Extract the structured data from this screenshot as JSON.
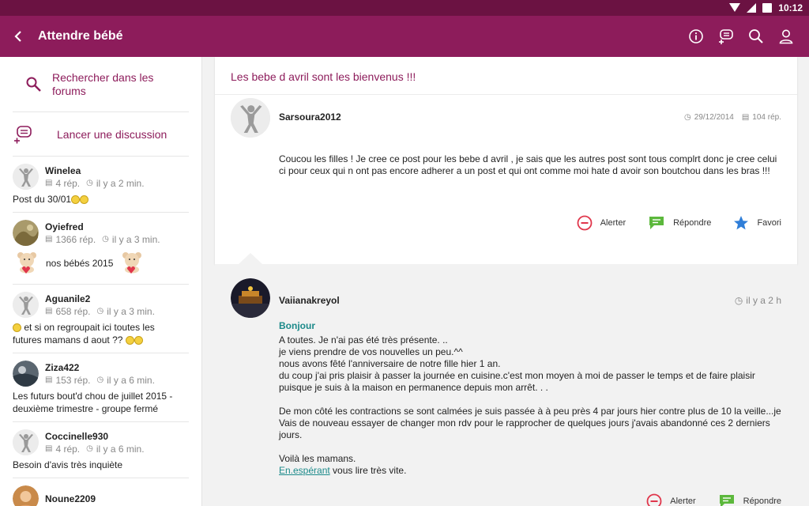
{
  "status": {
    "time": "10:12"
  },
  "app_bar": {
    "title": "Attendre bébé"
  },
  "sidebar": {
    "search_label": "Rechercher dans les forums",
    "new_discussion_label": "Lancer une discussion",
    "threads": [
      {
        "user": "Winelea",
        "replies": "4 rép.",
        "time": "il y a 2 min.",
        "title": "Post du 30/01"
      },
      {
        "user": "Oyiefred",
        "replies": "1366 rép.",
        "time": "il y a 3 min.",
        "title": "nos bébés 2015"
      },
      {
        "user": "Aguanile2",
        "replies": "658 rép.",
        "time": "il y a 3 min.",
        "title_a": "et si on regroupait ici toutes les",
        "title_b": "futures mamans d aout ??"
      },
      {
        "user": "Ziza422",
        "replies": "153 rép.",
        "time": "il y a 6 min.",
        "title_a": "Les futurs bout'd chou de juillet 2015 -",
        "title_b": "deuxième trimestre - groupe fermé"
      },
      {
        "user": "Coccinelle930",
        "replies": "4 rép.",
        "time": "il y a 6 min.",
        "title": "Besoin d'avis très inquiète"
      },
      {
        "user": "Noune2209"
      }
    ]
  },
  "post": {
    "title": "Les bebe d avril sont les bienvenus !!!",
    "author": "Sarsoura2012",
    "date": "29/12/2014",
    "replies": "104 rép.",
    "body": "Coucou les filles ! Je cree ce post pour les bebe d avril , je sais que les autres post sont tous complrt donc je cree celui ci pour ceux qui n ont pas encore adherer a un post et qui ont comme moi hate d avoir son boutchou dans les bras !!!",
    "actions": {
      "report": "Alerter",
      "reply": "Répondre",
      "fav": "Favori"
    }
  },
  "reply": {
    "author": "Vaiianakreyol",
    "time": "il y a 2 h",
    "greeting": "Bonjour",
    "lines": [
      "A toutes. Je n'ai pas été très présente. ..",
      "je viens prendre de vos nouvelles un peu.^^",
      "nous avons fêté l'anniversaire de notre fille hier 1 an.",
      "du coup j'ai pris plaisir à passer la journée en cuisine.c'est mon moyen à moi de passer le temps et de faire plaisir puisque je suis à la maison en permanence depuis mon arrêt. . ."
    ],
    "para2": "De mon côté les contractions se sont calmées je suis passée à à peu près 4 par jours hier contre plus de 10 la veille...je Vais de nouveau essayer de changer mon rdv pour le rapprocher de quelques jours j'avais abandonné ces 2 derniers jours.",
    "para3": "Voilà les mamans.",
    "link": "En.espérant",
    "closing": " vous lire très vite.",
    "actions": {
      "report": "Alerter",
      "reply": "Répondre"
    }
  },
  "colors": {
    "primary": "#8d1c5b",
    "status_bar": "#6b1242",
    "accent_teal": "#1c8a8a"
  }
}
